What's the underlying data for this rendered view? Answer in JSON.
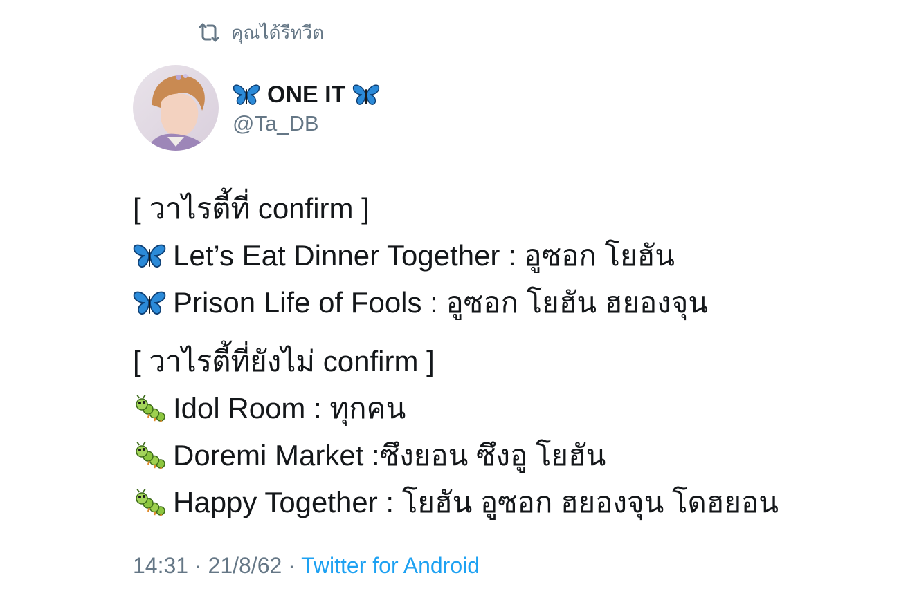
{
  "retweet": {
    "label": "คุณได้รีทวีต",
    "icon": "retweet-icon"
  },
  "author": {
    "display_name": "ONE IT",
    "name_emoji": "butterfly-icon",
    "handle": "@Ta_DB",
    "avatar": "profile-avatar"
  },
  "tweet": {
    "lines": [
      {
        "emoji": "",
        "text": "[ วาไรตี้ที่ confirm ]"
      },
      {
        "emoji": "butterfly-icon",
        "text": "Let’s Eat Dinner Together : อูซอก โยฮัน"
      },
      {
        "emoji": "butterfly-icon",
        "text": "Prison Life of Fools : อูซอก โยฮัน ฮยองจุน"
      },
      {
        "emoji": "",
        "text": "[ วาไรตี้ที่ยังไม่ confirm ]"
      },
      {
        "emoji": "caterpillar-icon",
        "text": "Idol Room : ทุกคน"
      },
      {
        "emoji": "caterpillar-icon",
        "text": "Doremi Market :ซึงยอน ซึงอู โยฮัน"
      },
      {
        "emoji": "caterpillar-icon",
        "text": "Happy Together : โยฮัน อูซอก ฮยองจุน โดฮยอน"
      }
    ]
  },
  "meta": {
    "time": "14:31",
    "separator": "·",
    "date": "21/8/62",
    "source": "Twitter for Android"
  },
  "colors": {
    "text": "#14171a",
    "secondary": "#657786",
    "link": "#1da1f2",
    "butterfly": "#2b8ad8",
    "caterpillar": "#8cc63f"
  }
}
